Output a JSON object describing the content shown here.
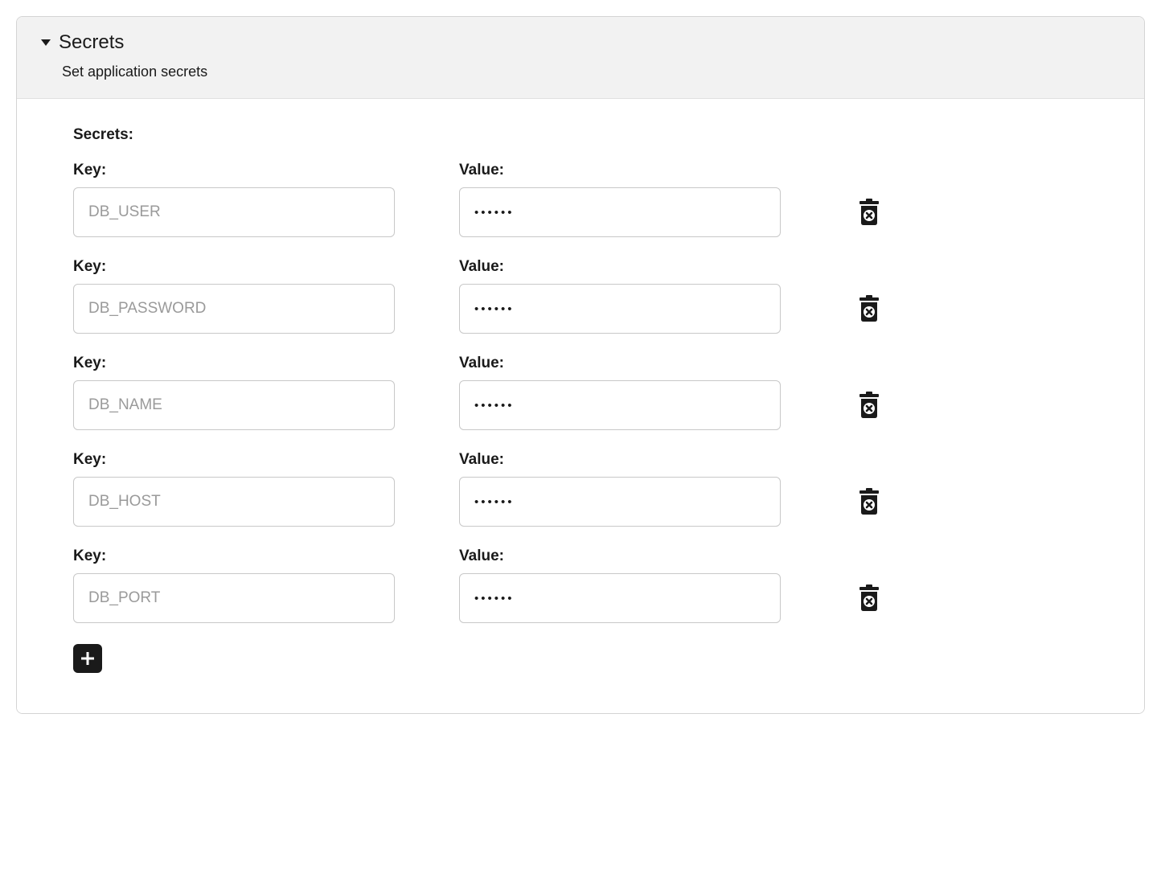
{
  "panel": {
    "title": "Secrets",
    "subtitle": "Set application secrets"
  },
  "section_label": "Secrets:",
  "labels": {
    "key": "Key:",
    "value": "Value:"
  },
  "rows": [
    {
      "key_placeholder": "DB_USER",
      "value": "••••••"
    },
    {
      "key_placeholder": "DB_PASSWORD",
      "value": "••••••"
    },
    {
      "key_placeholder": "DB_NAME",
      "value": "••••••"
    },
    {
      "key_placeholder": "DB_HOST",
      "value": "••••••"
    },
    {
      "key_placeholder": "DB_PORT",
      "value": "••••••"
    }
  ]
}
